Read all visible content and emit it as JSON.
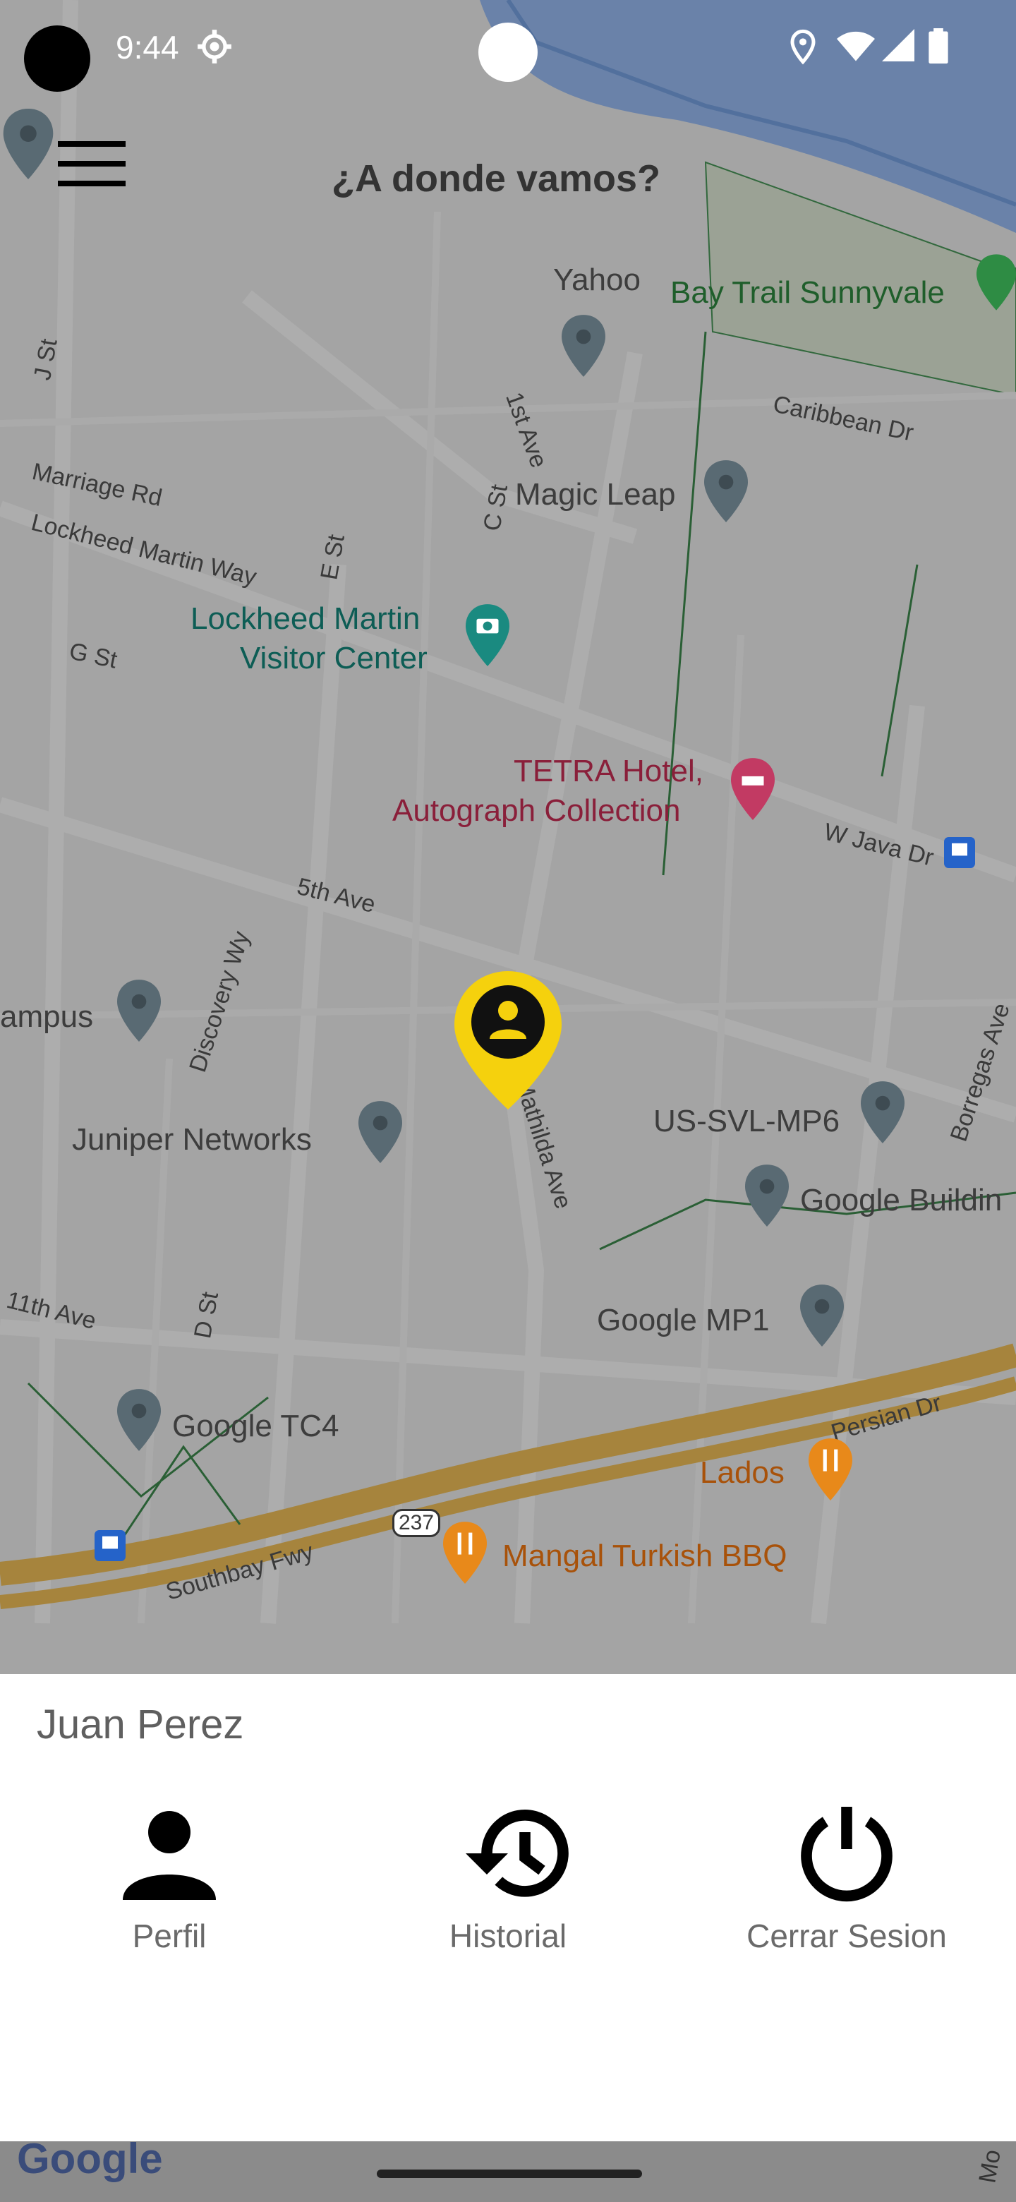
{
  "status_bar": {
    "time": "9:44"
  },
  "header": {
    "title": "¿A donde vamos?"
  },
  "map": {
    "places": [
      {
        "name": "Yahoo",
        "style": "gray"
      },
      {
        "name": "Bay Trail Sunnyvale",
        "style": "green"
      },
      {
        "name": "Magic Leap",
        "style": "gray"
      },
      {
        "name": "Lockheed Martin",
        "style": "teal"
      },
      {
        "name": "Visitor Center",
        "style": "teal"
      },
      {
        "name": "TETRA Hotel,",
        "style": "rose"
      },
      {
        "name": "Autograph Collection",
        "style": "rose"
      },
      {
        "name": "ampus",
        "style": "gray"
      },
      {
        "name": "Juniper Networks",
        "style": "gray"
      },
      {
        "name": "US-SVL-MP6",
        "style": "gray"
      },
      {
        "name": "Google Buildin",
        "style": "gray"
      },
      {
        "name": "Google MP1",
        "style": "gray"
      },
      {
        "name": "Google TC4",
        "style": "gray"
      },
      {
        "name": "Lados",
        "style": "orange"
      },
      {
        "name": "Mangal Turkish BBQ",
        "style": "orange"
      }
    ],
    "streets": [
      "J St",
      "1st Ave",
      "C St",
      "Caribbean Dr",
      "Marriage Rd",
      "Lockheed Martin Way",
      "E St",
      "G St",
      "W Java Dr",
      "5th Ave",
      "Discovery Wy",
      "Mathilda Ave",
      "Borregas Ave",
      "11th Ave",
      "D St",
      "Persian Dr",
      "Southbay Fwy",
      "237"
    ],
    "attribution": "Google",
    "edge_label": "Mo"
  },
  "sheet": {
    "user_name": "Juan Perez",
    "actions": [
      {
        "label": "Perfil",
        "icon": "person-icon"
      },
      {
        "label": "Historial",
        "icon": "history-icon"
      },
      {
        "label": "Cerrar Sesion",
        "icon": "power-icon"
      }
    ]
  }
}
